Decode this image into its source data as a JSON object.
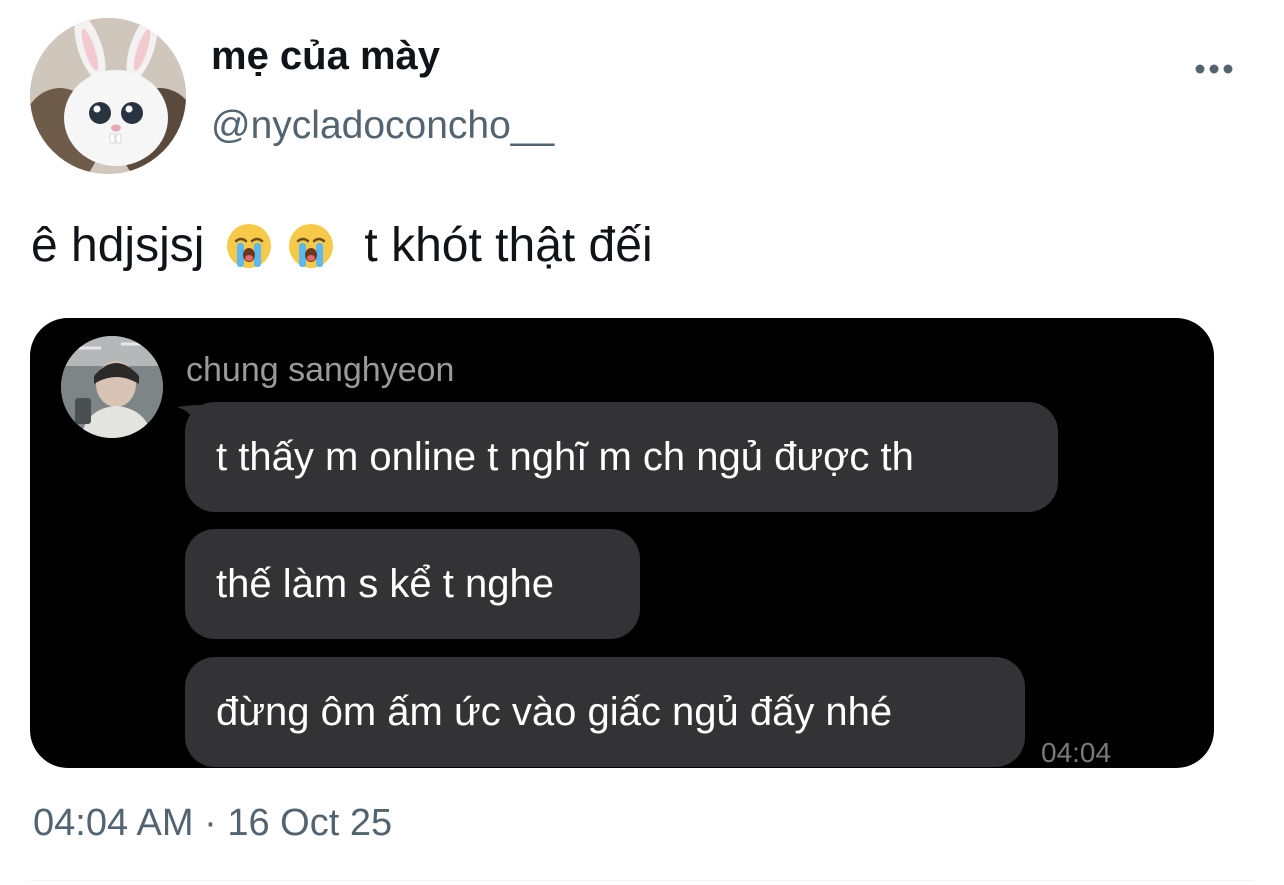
{
  "author": {
    "display_name": "mẹ của mày",
    "handle": "@nycladoconcho__"
  },
  "tweet": {
    "text_before": "ê hdjsjsj",
    "emojis": [
      "loudly-crying-face-emoji",
      "loudly-crying-face-emoji"
    ],
    "text_after": "t khót thật đếi"
  },
  "chat": {
    "sender": "chung sanghyeon",
    "messages": [
      "t thấy m online t nghĩ m ch ngủ được th",
      "thế làm s kể t nghe",
      "đừng ôm ấm ức vào giấc ngủ đấy nhé"
    ],
    "time": "04:04"
  },
  "footer": {
    "timestamp": "04:04 AM · 16 Oct 25"
  },
  "colors": {
    "text_primary": "#0f1419",
    "text_secondary": "#536471",
    "chat_background": "#000000",
    "bubble": "#333336"
  }
}
